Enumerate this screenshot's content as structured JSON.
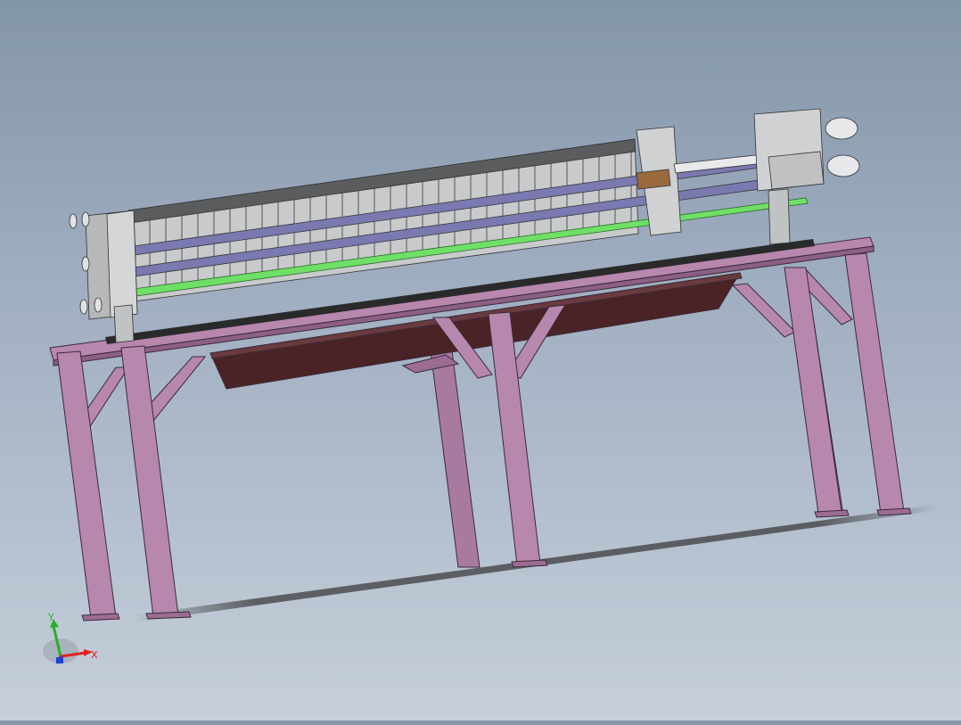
{
  "viewport": {
    "background_top": "#8496aa",
    "background_bottom": "#c6cfda"
  },
  "model": {
    "frame_color": "#b887ad",
    "frame_shade": "#9c6c92",
    "tray_color": "#4a2327",
    "plate_color": "#d2d4d6",
    "rail_color": "#7a79b0",
    "hose_color": "#6fe066",
    "block_color": "#9a6a3e"
  },
  "triad": {
    "x_label": "X",
    "y_label": "Y",
    "x_color": "#e02020",
    "y_color": "#28b028",
    "z_color": "#2040d0"
  }
}
